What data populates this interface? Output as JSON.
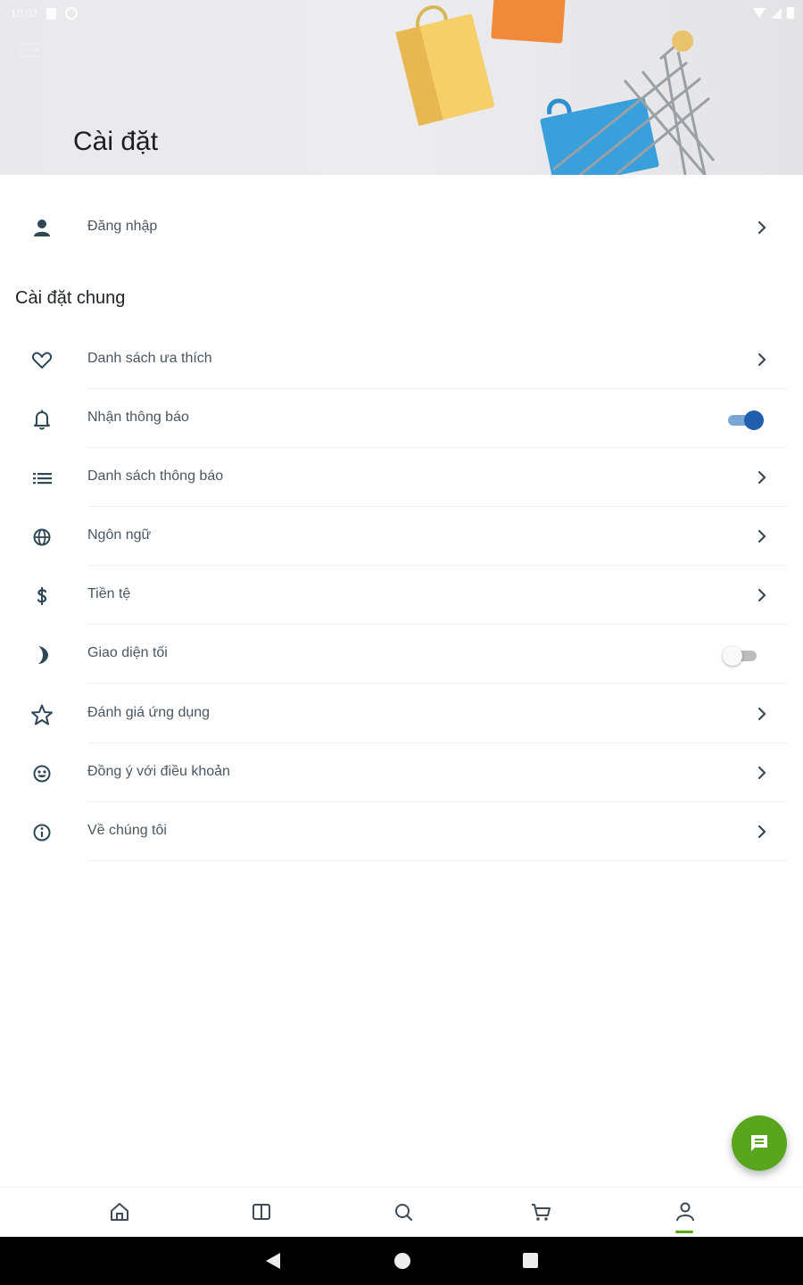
{
  "status_bar": {
    "time": "10:02"
  },
  "header": {
    "title": "Cài đặt"
  },
  "login_row": {
    "label": "Đăng nhập",
    "icon": "person-icon"
  },
  "section": {
    "title": "Cài đặt chung"
  },
  "settings": [
    {
      "label": "Danh sách ưa thích",
      "icon": "heart-icon",
      "control": "chevron"
    },
    {
      "label": "Nhận thông báo",
      "icon": "bell-icon",
      "control": "toggle",
      "toggle_on": true
    },
    {
      "label": "Danh sách thông báo",
      "icon": "list-icon",
      "control": "chevron"
    },
    {
      "label": "Ngôn ngữ",
      "icon": "globe-icon",
      "control": "chevron"
    },
    {
      "label": "Tiền tệ",
      "icon": "dollar-icon",
      "control": "chevron"
    },
    {
      "label": "Giao diện tối",
      "icon": "moon-icon",
      "control": "toggle",
      "toggle_on": false
    },
    {
      "label": "Đánh giá ứng dụng",
      "icon": "star-icon",
      "control": "chevron"
    },
    {
      "label": "Đồng ý với điều khoản",
      "icon": "smile-icon",
      "control": "chevron"
    },
    {
      "label": "Về chúng tôi",
      "icon": "info-icon",
      "control": "chevron"
    }
  ],
  "bottom_nav": {
    "items": [
      "home-icon",
      "category-icon",
      "search-icon",
      "cart-icon",
      "account-icon"
    ],
    "active": "account-icon"
  },
  "fab": {
    "icon": "chat-icon"
  },
  "colors": {
    "accent": "#5aa51e",
    "toggle_on": "#1f5fae",
    "icon": "#2f4756",
    "text": "#4a5661"
  }
}
